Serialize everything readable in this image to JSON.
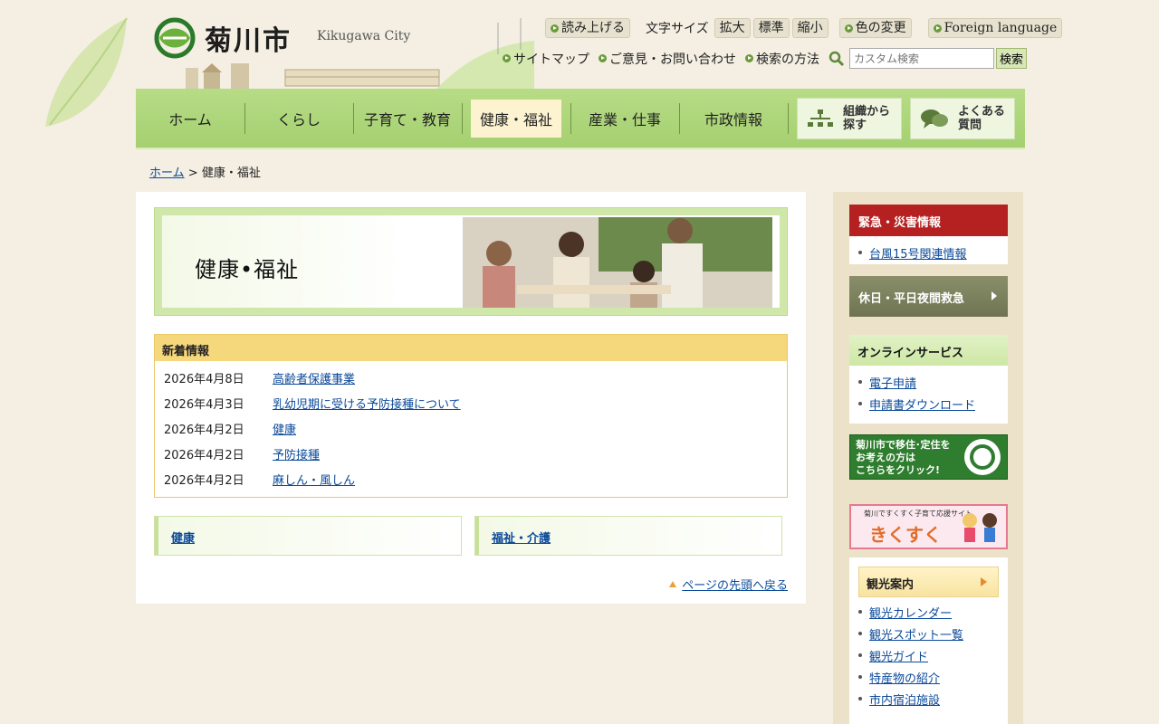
{
  "header": {
    "logo_text": "菊川市",
    "logo_en": "Kikugawa City",
    "read_aloud": "読み上げる",
    "font_size_label": "文字サイズ",
    "font_large": "拡大",
    "font_standard": "標準",
    "font_small": "縮小",
    "color_change": "色の変更",
    "foreign_language": "Foreign language",
    "sitemap": "サイトマップ",
    "opinion": "ご意見・お問い合わせ",
    "search_method": "検索の方法",
    "search_placeholder": "カスタム検索",
    "search_button": "検索"
  },
  "nav": {
    "items": [
      "ホーム",
      "くらし",
      "子育て・教育",
      "健康・福祉",
      "産業・仕事",
      "市政情報"
    ],
    "active_index": 3,
    "org_search": "組織から\n探す",
    "faq": "よくある\n質問"
  },
  "breadcrumb": {
    "home": "ホーム",
    "separator": ">",
    "current": "健康・福祉"
  },
  "banner": {
    "title": "健康•福祉"
  },
  "news": {
    "heading": "新着情報",
    "items": [
      {
        "date": "2026年4月8日",
        "title": "高齢者保護事業"
      },
      {
        "date": "2026年4月3日",
        "title": "乳幼児期に受ける予防接種について"
      },
      {
        "date": "2026年4月2日",
        "title": "健康"
      },
      {
        "date": "2026年4月2日",
        "title": "予防接種"
      },
      {
        "date": "2026年4月2日",
        "title": "麻しん・風しん"
      }
    ]
  },
  "categories": [
    "健康",
    "福祉・介護"
  ],
  "back_to_top": "ページの先頭へ戻る",
  "sidebar": {
    "emergency_heading": "緊急・災害情報",
    "emergency_items": [
      "台風15号関連情報"
    ],
    "night_emergency": "休日・平日夜間救急",
    "online_heading": "オンラインサービス",
    "online_items": [
      "電子申請",
      "申請書ダウンロード"
    ],
    "banner_migration": "菊川市で移住･定住を\nお考えの方は\nこちらをクリック!",
    "banner_kids_small": "菊川ですくすく子育て応援サイト",
    "banner_kids": "きくすく",
    "tourism_heading": "観光案内",
    "tourism_items": [
      "観光カレンダー",
      "観光スポット一覧",
      "観光ガイド",
      "特産物の紹介",
      "市内宿泊施設"
    ]
  },
  "colors": {
    "nav_green": "#a5d070",
    "emergency_red": "#b52121",
    "news_header": "#f5d77c",
    "link": "#0b4a9a"
  }
}
